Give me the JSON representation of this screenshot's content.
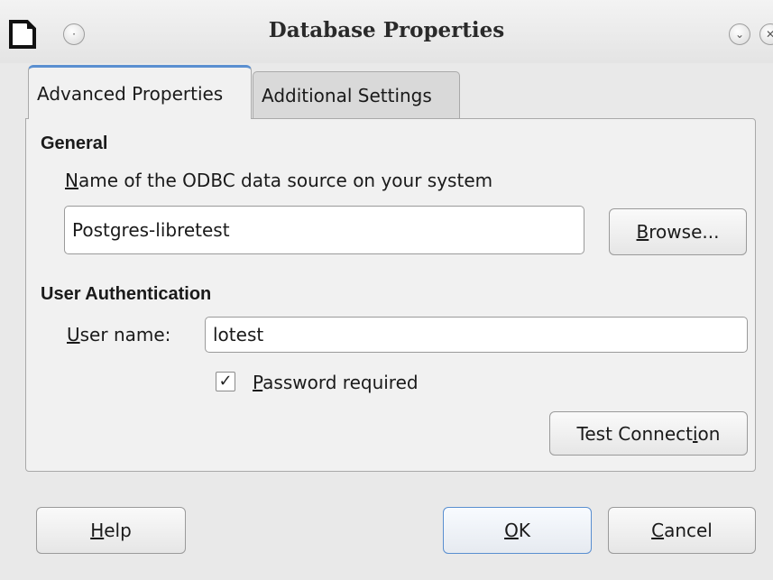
{
  "window": {
    "title": "Database Properties",
    "icons": [
      "document-icon",
      "window-menu-icon",
      "minimize-icon",
      "close-icon"
    ]
  },
  "tabs": [
    {
      "label": "Advanced Properties",
      "active": true
    },
    {
      "label": "Additional Settings",
      "active": false
    }
  ],
  "general": {
    "heading": "General",
    "datasource_label_mnemonic": "N",
    "datasource_label_rest": "ame of the ODBC data source on your system",
    "datasource_value": "Postgres-libretest",
    "browse_mnemonic": "B",
    "browse_rest": "rowse..."
  },
  "auth": {
    "heading": "User Authentication",
    "username_label_mnemonic": "U",
    "username_label_rest": "ser name:",
    "username_value": "lotest",
    "password_required_mnemonic": "P",
    "password_required_rest": "assword required",
    "password_required_checked": true,
    "checkmark": "✓",
    "test_connection_pre": "Test Connect",
    "test_connection_mnemonic": "i",
    "test_connection_post": "on"
  },
  "footer": {
    "help_mnemonic": "H",
    "help_rest": "elp",
    "ok_mnemonic": "O",
    "ok_rest": "K",
    "cancel_mnemonic": "C",
    "cancel_rest": "ancel"
  }
}
